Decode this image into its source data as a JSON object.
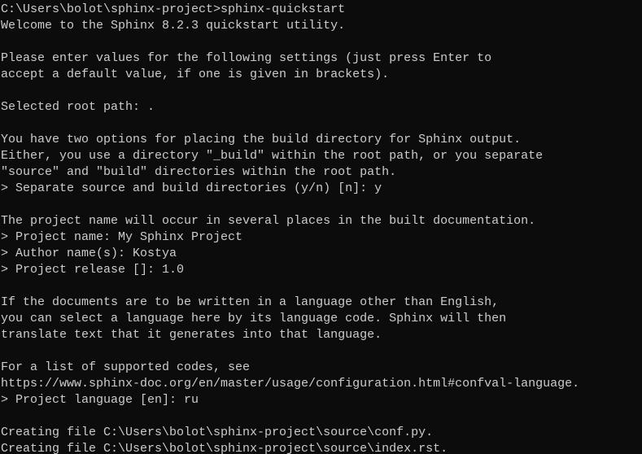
{
  "terminal": {
    "lines": [
      "C:\\Users\\bolot\\sphinx-project>sphinx-quickstart",
      "Welcome to the Sphinx 8.2.3 quickstart utility.",
      "",
      "Please enter values for the following settings (just press Enter to",
      "accept a default value, if one is given in brackets).",
      "",
      "Selected root path: .",
      "",
      "You have two options for placing the build directory for Sphinx output.",
      "Either, you use a directory \"_build\" within the root path, or you separate",
      "\"source\" and \"build\" directories within the root path.",
      "> Separate source and build directories (y/n) [n]: y",
      "",
      "The project name will occur in several places in the built documentation.",
      "> Project name: My Sphinx Project",
      "> Author name(s): Kostya",
      "> Project release []: 1.0",
      "",
      "If the documents are to be written in a language other than English,",
      "you can select a language here by its language code. Sphinx will then",
      "translate text that it generates into that language.",
      "",
      "For a list of supported codes, see",
      "https://www.sphinx-doc.org/en/master/usage/configuration.html#confval-language.",
      "> Project language [en]: ru",
      "",
      "Creating file C:\\Users\\bolot\\sphinx-project\\source\\conf.py.",
      "Creating file C:\\Users\\bolot\\sphinx-project\\source\\index.rst."
    ]
  }
}
